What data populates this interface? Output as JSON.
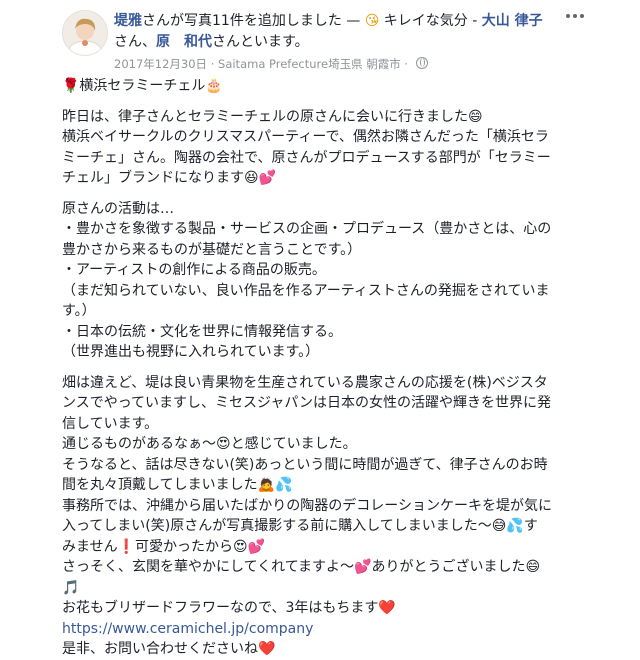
{
  "header": {
    "author": "堤雅",
    "added_text": "さんが写真11件を追加しました — ",
    "feeling_emoji": "😘",
    "feeling": " キレイな気分",
    "with_sep": " - ",
    "tagged1": "大山 律子",
    "with_text1": "さん、",
    "tagged2": "原　和代",
    "with_text2": "さんといます。",
    "date": "2017年12月30日",
    "place_sep": " · ",
    "location": "Saitama Prefecture埼玉県 朝霞市",
    "dot": " · "
  },
  "post": {
    "title": "🌹横浜セラミーチェル🎂",
    "p1": [
      "昨日は、律子さんとセラミーチェルの原さんに会いに行きました😄",
      "横浜ベイサークルのクリスマスパーティーで、偶然お隣さんだった「横浜セラ",
      "ミーチェ」さん。陶器の会社で、原さんがプロデュースする部門が「セラミー",
      "チェル」ブランドになります😆💕"
    ],
    "p2": [
      "原さんの活動は…",
      "・豊かさを象徴する製品・サービスの企画・プロデュース（豊かさとは、心の",
      "豊かさから来るものが基礎だと言うことです。）",
      "・アーティストの創作による商品の販売。",
      "（まだ知られていない、良い作品を作るアーティストさんの発掘をされていま",
      "す。）",
      "・日本の伝統・文化を世界に情報発信する。",
      "（世界進出も視野に入れられています。）"
    ],
    "p3": [
      "畑は違えど、堤は良い青果物を生産されている農家さんの応援を(株)ベジスタ",
      "ンスでやっていますし、ミセスジャパンは日本の女性の活躍や輝きを世界に発",
      "信しています。",
      "通じるものがあるなぁ〜😍と感じていました。",
      "そうなると、話は尽きない(笑)あっという間に時間が過ぎて、律子さんのお時",
      "間を丸々頂戴してしまいました🙇💦",
      "事務所では、沖縄から届いたばかりの陶器のデコレーションケーキを堤が気に",
      "入ってしまい(笑)原さんが写真撮影する前に購入してしまいました〜😅💦す",
      "みません❗可愛かったから😍💕",
      "さっそく、玄関を華やかにしてくれてますよ〜💕ありがとうございました😄",
      "🎵",
      "お花もブリザードフラワーなので、3年はもちます❤️"
    ],
    "url": "https://www.ceramichel.jp/company",
    "closing": "是非、お問い合わせくださいね❤️"
  }
}
